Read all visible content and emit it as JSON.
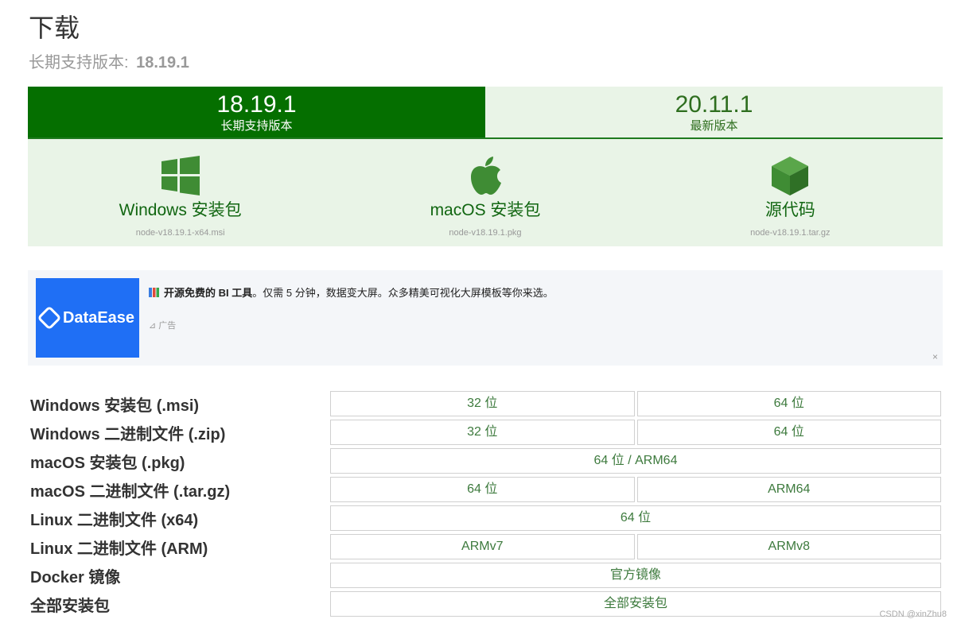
{
  "header": {
    "title": "下载",
    "lts_prefix": "长期支持版本:",
    "lts_version": "18.19.1"
  },
  "version_tabs": [
    {
      "version": "18.19.1",
      "label": "长期支持版本",
      "active": true
    },
    {
      "version": "20.11.1",
      "label": "最新版本",
      "active": false
    }
  ],
  "downloads": [
    {
      "name": "Windows 安装包",
      "file": "node-v18.19.1-x64.msi",
      "icon": "windows-icon"
    },
    {
      "name": "macOS 安装包",
      "file": "node-v18.19.1.pkg",
      "icon": "apple-icon"
    },
    {
      "name": "源代码",
      "file": "node-v18.19.1.tar.gz",
      "icon": "source-box-icon"
    }
  ],
  "ad": {
    "logo_text": "DataEase",
    "headline_bold": "开源免费的 BI 工具",
    "headline_rest": "。仅需 5 分钟，数据变大屏。众多精美可视化大屏模板等你来选。",
    "tag": "广告",
    "close": "×"
  },
  "table": [
    {
      "label": "Windows 安装包 (.msi)",
      "cells": [
        "32 位",
        "64 位"
      ]
    },
    {
      "label": "Windows 二进制文件 (.zip)",
      "cells": [
        "32 位",
        "64 位"
      ]
    },
    {
      "label": "macOS 安装包 (.pkg)",
      "cells": [
        "64 位 / ARM64"
      ]
    },
    {
      "label": "macOS 二进制文件 (.tar.gz)",
      "cells": [
        "64 位",
        "ARM64"
      ]
    },
    {
      "label": "Linux 二进制文件 (x64)",
      "cells": [
        "64 位"
      ]
    },
    {
      "label": "Linux 二进制文件 (ARM)",
      "cells": [
        "ARMv7",
        "ARMv8"
      ]
    },
    {
      "label": "Docker 镜像",
      "cells": [
        "官方镜像"
      ]
    },
    {
      "label": "全部安装包",
      "cells": [
        "全部安装包"
      ]
    }
  ],
  "watermark": "CSDN @xinZhu8",
  "colors": {
    "brand_green": "#056f00",
    "light_green": "#e9f4e7",
    "link_green": "#3d7a3d"
  }
}
